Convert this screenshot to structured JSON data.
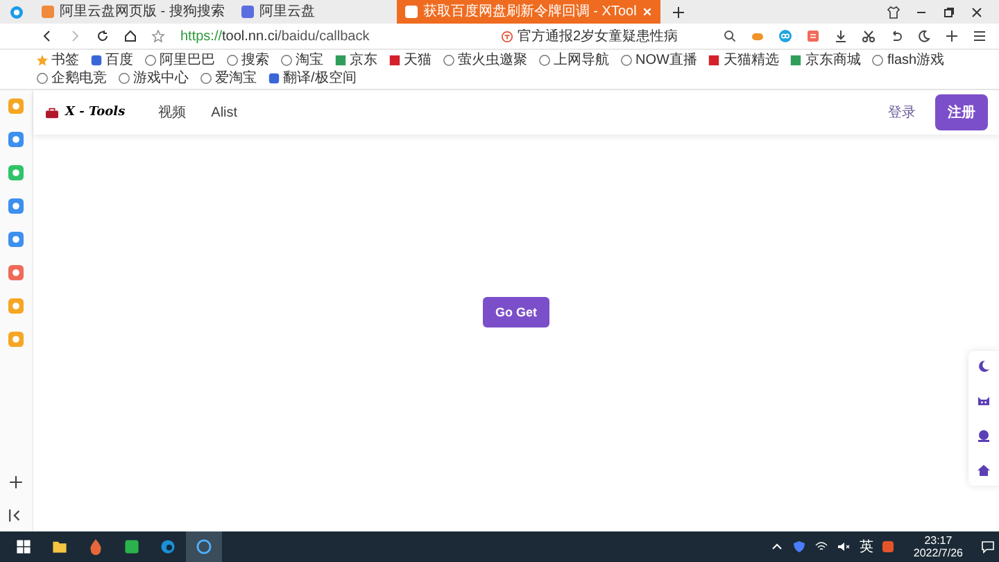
{
  "tabs": [
    {
      "title": "阿里云盘网页版 - 搜狗搜索",
      "selected": false,
      "color": "#f08a3c"
    },
    {
      "title": "阿里云盘",
      "selected": false,
      "color": "#5b6ee1"
    },
    {
      "title": "获取百度网盘刷新令牌回调 - XTool",
      "selected": true,
      "color": "#ffffff"
    }
  ],
  "address": {
    "url_scheme": "https://",
    "url_host": "tool.nn.ci",
    "url_path": "/baidu/callback"
  },
  "search": {
    "placeholder": "官方通报2岁女童疑患性病"
  },
  "bookmarks": [
    {
      "label": "书签",
      "kind": "star"
    },
    {
      "label": "百度",
      "kind": "blue"
    },
    {
      "label": "阿里巴巴",
      "kind": "globe"
    },
    {
      "label": "搜索",
      "kind": "globe"
    },
    {
      "label": "淘宝",
      "kind": "globe"
    },
    {
      "label": "京东",
      "kind": "green"
    },
    {
      "label": "天猫",
      "kind": "red"
    },
    {
      "label": "萤火虫邀聚",
      "kind": "globe"
    },
    {
      "label": "上网导航",
      "kind": "globe"
    },
    {
      "label": "NOW直播",
      "kind": "globe"
    },
    {
      "label": "天猫精选",
      "kind": "red"
    },
    {
      "label": "京东商城",
      "kind": "green"
    },
    {
      "label": "flash游戏",
      "kind": "globe"
    },
    {
      "label": "企鹅电竞",
      "kind": "globe"
    },
    {
      "label": "游戏中心",
      "kind": "globe"
    },
    {
      "label": "爱淘宝",
      "kind": "globe"
    },
    {
      "label": "翻译/极空间",
      "kind": "blue"
    }
  ],
  "sidebar": [
    {
      "color": "#f5a623"
    },
    {
      "color": "#3d8ff0"
    },
    {
      "color": "#2fc36b"
    },
    {
      "color": "#3d8ff0"
    },
    {
      "color": "#3d8ff0"
    },
    {
      "color": "#f06a5a"
    },
    {
      "color": "#f5a623"
    },
    {
      "color": "#f5a623"
    }
  ],
  "site": {
    "logo": "X - Tools",
    "nav": [
      "视频",
      "Alist"
    ],
    "login": "登录",
    "register": "注册",
    "action": "Go Get"
  },
  "taskbar": {
    "ime": "英",
    "time": "23:17",
    "date": "2022/7/26"
  }
}
